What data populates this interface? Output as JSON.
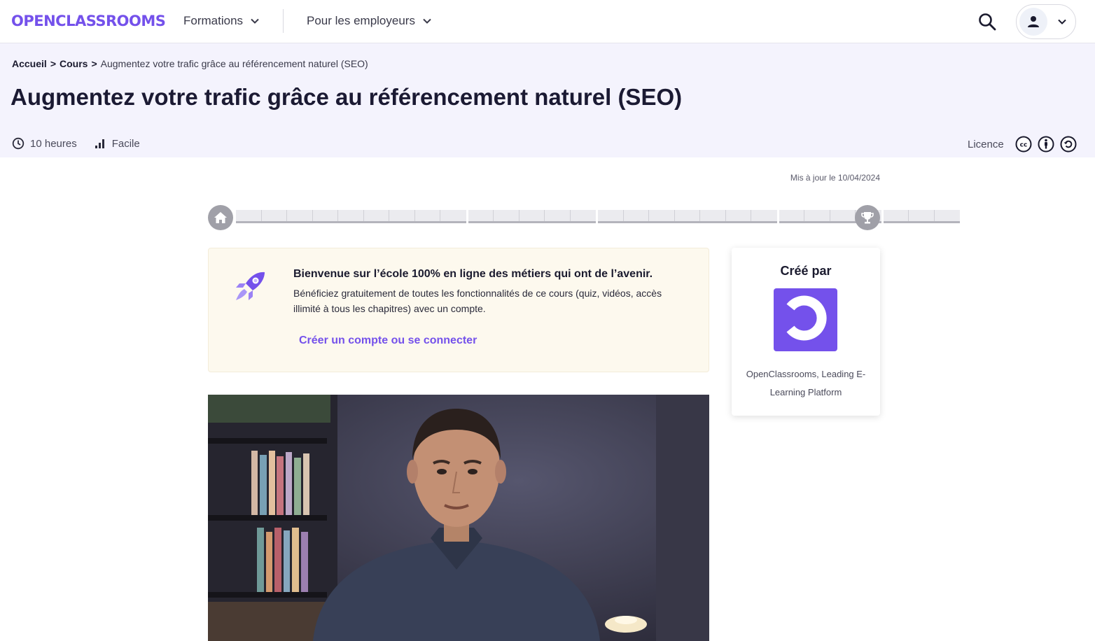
{
  "nav": {
    "logo": "OPENCLASSROOMS",
    "formations": "Formations",
    "employeurs": "Pour les employeurs"
  },
  "breadcrumb": {
    "home": "Accueil",
    "courses": "Cours",
    "separator": ">",
    "current": "Augmentez votre trafic grâce au référencement naturel (SEO)"
  },
  "course": {
    "title": "Augmentez votre trafic grâce au référencement naturel (SEO)",
    "duration": "10 heures",
    "difficulty": "Facile",
    "licence_label": "Licence",
    "licence_icons": [
      "creative-commons-icon",
      "attribution-icon",
      "share-alike-icon"
    ],
    "updated": "Mis à jour le 10/04/2024"
  },
  "progress": {
    "parts": [
      9,
      5,
      7,
      4,
      3
    ],
    "start_icon": "home-icon",
    "end_icon": "trophy-icon"
  },
  "welcome": {
    "title": "Bienvenue sur l’école 100% en ligne des métiers qui ont de l’avenir.",
    "text": "Bénéficiez gratuitement de toutes les fonctionnalités de ce cours (quiz, vidéos, accès illimité à tous les chapitres) avec un compte.",
    "link": "Créer un compte ou se connecter"
  },
  "author": {
    "heading": "Créé par",
    "name": "OpenClassrooms, Leading E-Learning Platform"
  },
  "colors": {
    "brand": "#7451eb",
    "header_bg": "#f4f3fd",
    "welcome_bg": "#fdf9ee"
  }
}
